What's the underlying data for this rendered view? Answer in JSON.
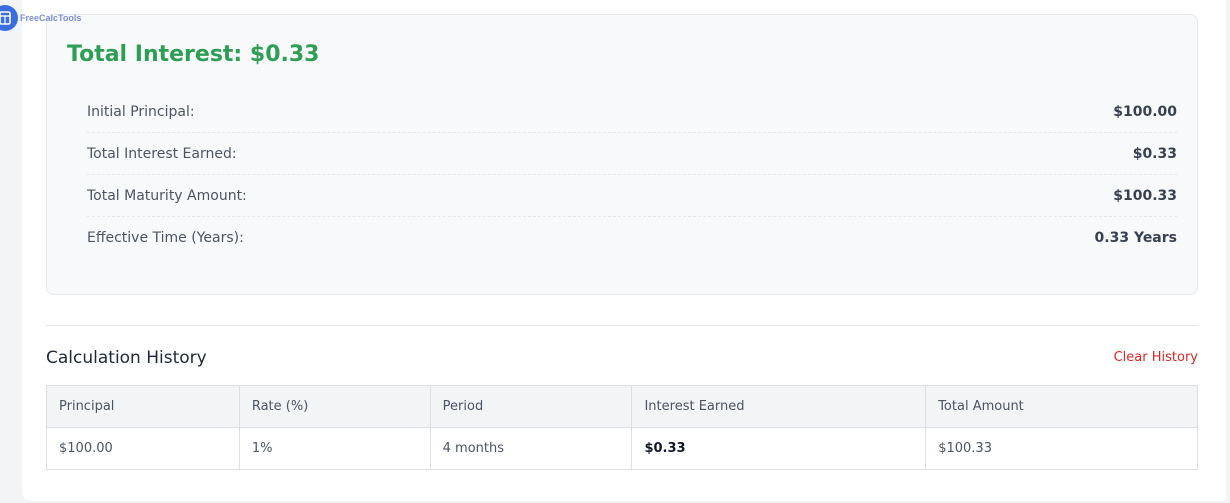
{
  "logo": {
    "text": "FreeCalcTools"
  },
  "result": {
    "title": "Total Interest: $0.33",
    "rows": [
      {
        "label": "Initial Principal:",
        "value": "$100.00"
      },
      {
        "label": "Total Interest Earned:",
        "value": "$0.33"
      },
      {
        "label": "Total Maturity Amount:",
        "value": "$100.33"
      },
      {
        "label": "Effective Time (Years):",
        "value": "0.33 Years"
      }
    ]
  },
  "history": {
    "title": "Calculation History",
    "clear_label": "Clear History",
    "columns": [
      "Principal",
      "Rate (%)",
      "Period",
      "Interest Earned",
      "Total Amount"
    ],
    "rows": [
      {
        "principal": "$100.00",
        "rate": "1%",
        "period": "4 months",
        "interest": "$0.33",
        "total": "$100.33"
      }
    ]
  },
  "colors": {
    "accent_green": "#2e9e55",
    "danger_red": "#dc2626",
    "logo_blue": "#3b6fe0"
  }
}
